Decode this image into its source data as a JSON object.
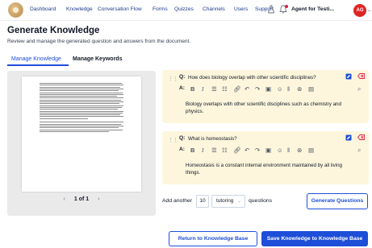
{
  "nav": {
    "items": [
      "Dashboard",
      "Knowledge",
      "Conversation Flow",
      "Forms",
      "Quizzes",
      "Channels",
      "Users",
      "Support"
    ],
    "agent_name": "Agent for Testi...",
    "avatar_initials": "AG",
    "icons": [
      "app-logo",
      "flask-icon",
      "bell-icon"
    ]
  },
  "header": {
    "title": "Generate Knowledge",
    "subtitle": "Review and manage the generated question and answers from the document."
  },
  "tabs": [
    {
      "label": "Manage Knowledge",
      "active": true
    },
    {
      "label": "Manage Keywords",
      "active": false
    }
  ],
  "preview": {
    "page_current": "1",
    "page_of": "of",
    "page_total": "1"
  },
  "qa": [
    {
      "q_label": "Q:",
      "question": "How does biology overlap with other scientific disciplines?",
      "a_label": "A:",
      "answer": "Biology overlaps with other scientific disciplines such as chemistry and physics."
    },
    {
      "q_label": "Q:",
      "question": "What is homeostasis?",
      "a_label": "A:",
      "answer": "Homeostasis is a constant internal environment maintained by all living things."
    }
  ],
  "generator": {
    "prefix": "Add another",
    "count": "10",
    "type": "tutoring",
    "suffix": "questions",
    "button": "Generate Questions"
  },
  "footer": {
    "return_label": "Return to Knowledge Base",
    "save_label": "Save Knowledge to Knowledge Base"
  },
  "colors": {
    "accent": "#1d4ed8",
    "card_bg": "#fdf6dc",
    "danger": "#e11d48",
    "avatar": "#dc2626"
  }
}
